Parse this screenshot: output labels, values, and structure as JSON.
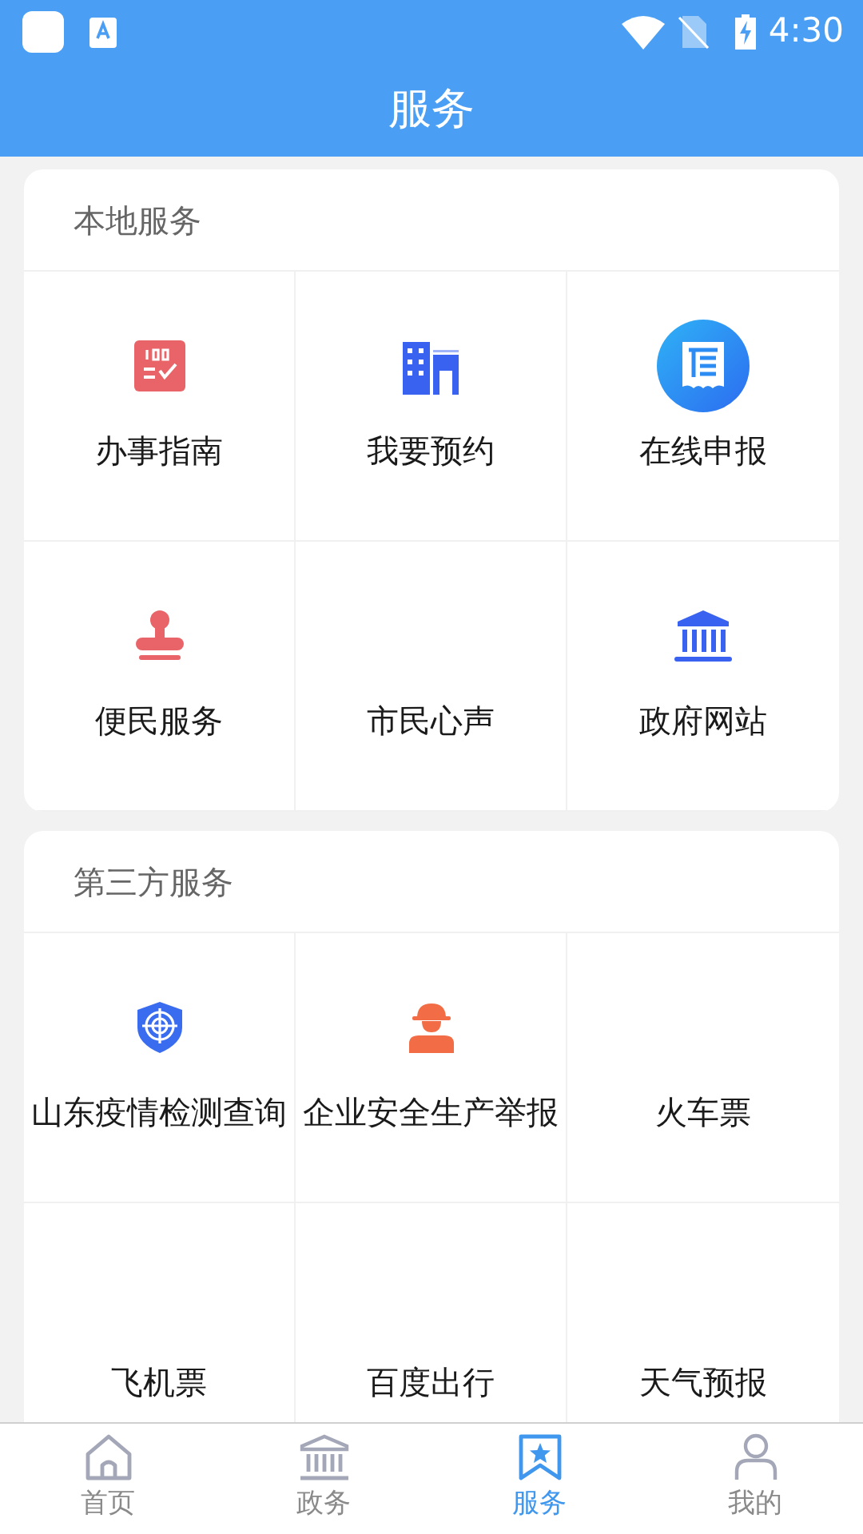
{
  "status_bar": {
    "time": "4:30"
  },
  "header": {
    "title": "服务"
  },
  "sections": [
    {
      "title": "本地服务",
      "items": [
        {
          "label": "办事指南",
          "has_icon": true
        },
        {
          "label": "我要预约",
          "has_icon": true
        },
        {
          "label": "在线申报",
          "has_icon": true
        },
        {
          "label": "便民服务",
          "has_icon": true
        },
        {
          "label": "市民心声",
          "has_icon": false
        },
        {
          "label": "政府网站",
          "has_icon": true
        }
      ]
    },
    {
      "title": "第三方服务",
      "items": [
        {
          "label": "山东疫情检测查询",
          "has_icon": true
        },
        {
          "label": "企业安全生产举报",
          "has_icon": true
        },
        {
          "label": "火车票",
          "has_icon": false
        },
        {
          "label": "飞机票",
          "has_icon": false
        },
        {
          "label": "百度出行",
          "has_icon": false
        },
        {
          "label": "天气预报",
          "has_icon": false
        }
      ]
    }
  ],
  "tab_bar": [
    {
      "label": "首页",
      "selected": false
    },
    {
      "label": "政务",
      "selected": false
    },
    {
      "label": "服务",
      "selected": true
    },
    {
      "label": "我的",
      "selected": false
    }
  ]
}
